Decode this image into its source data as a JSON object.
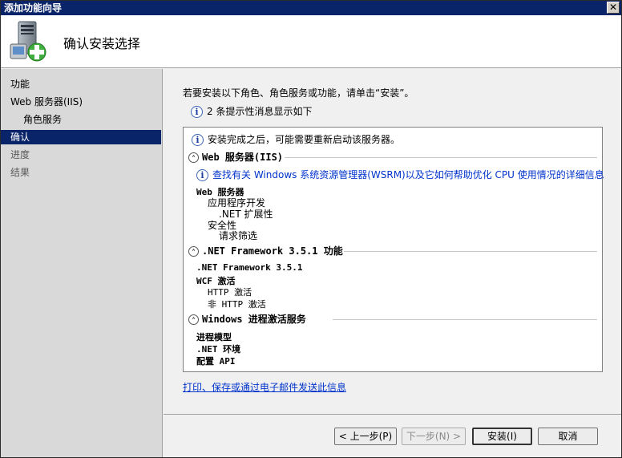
{
  "window": {
    "title": "添加功能向导",
    "close_glyph": "✕"
  },
  "header": {
    "title": "确认安装选择"
  },
  "sidebar": {
    "items": [
      {
        "label": "功能"
      },
      {
        "label": "Web 服务器(IIS)"
      },
      {
        "label": "角色服务"
      },
      {
        "label": "确认"
      },
      {
        "label": "进度"
      },
      {
        "label": "结果"
      }
    ]
  },
  "main": {
    "intro": "若要安装以下角色、角色服务或功能，请单击“安装”。",
    "info_summary": "2 条提示性消息显示如下",
    "panel": {
      "restart_notice": "安装完成之后，可能需要重新启动该服务器。",
      "sections": [
        {
          "title": "Web 服务器(IIS)",
          "info_link": "查找有关 Windows 系统资源管理器(WSRM)以及它如何帮助优化 CPU 使用情况的详细信息",
          "items": [
            "Web 服务器",
            "应用程序开发",
            ".NET 扩展性",
            "安全性",
            "请求筛选"
          ]
        },
        {
          "title": ".NET Framework 3.5.1 功能",
          "items": [
            ".NET Framework 3.5.1",
            "WCF 激活",
            "HTTP 激活",
            "非 HTTP 激活"
          ]
        },
        {
          "title": "Windows 进程激活服务",
          "items": [
            "进程模型",
            ".NET 环境",
            "配置 API"
          ]
        }
      ]
    },
    "footer_link": "打印、保存或通过电子邮件发送此信息"
  },
  "buttons": {
    "back": "< 上一步(P)",
    "next": "下一步(N) >",
    "install": "安装(I)",
    "cancel": "取消"
  },
  "colors": {
    "titlebar": "#0a246a",
    "selected": "#0a246a",
    "link": "#0033cc"
  },
  "icons": {
    "header": "server-add-icon",
    "info": "info-icon",
    "collapse": "collapse-chevron-icon"
  }
}
